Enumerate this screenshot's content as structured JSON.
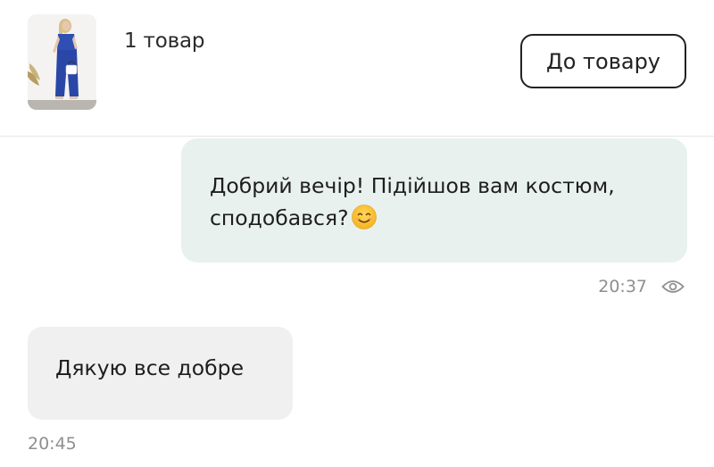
{
  "product": {
    "count_label": "1 товар",
    "button_label": "До товару"
  },
  "messages": [
    {
      "direction": "outgoing",
      "line1": "Добрий вечір! Підійшов вам костюм,",
      "line2": "сподобався?",
      "emoji": "smiling-face-icon",
      "time": "20:37",
      "status_icon": "eye-icon"
    },
    {
      "direction": "incoming",
      "text": "Дякую все добре",
      "time": "20:45"
    }
  ],
  "colors": {
    "outgoing_bubble": "#e9f1ef",
    "incoming_bubble": "#f0f0f0",
    "timestamp": "#8f8f8f",
    "product_outfit": "#2f4fb4"
  }
}
